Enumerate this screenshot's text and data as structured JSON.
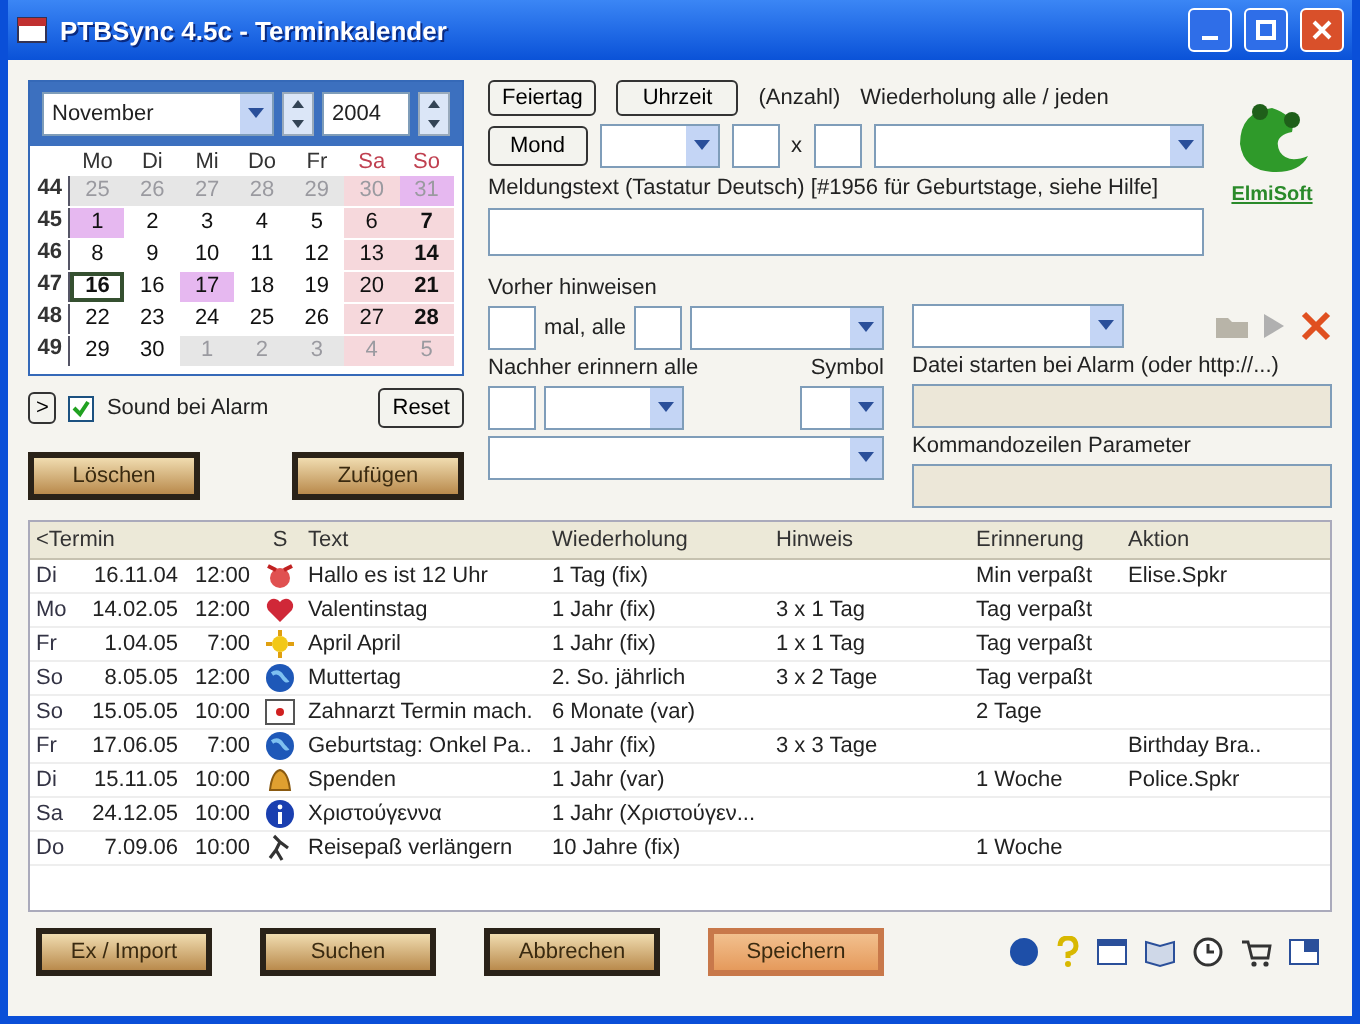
{
  "window": {
    "title": "PTBSync 4.5c - Terminkalender"
  },
  "calendar": {
    "month": "November",
    "year": "2004",
    "weekdays": [
      {
        "label": "Mo",
        "kind": "weekday"
      },
      {
        "label": "Di",
        "kind": "weekday"
      },
      {
        "label": "Mi",
        "kind": "weekday"
      },
      {
        "label": "Do",
        "kind": "weekday"
      },
      {
        "label": "Fr",
        "kind": "weekday"
      },
      {
        "label": "Sa",
        "kind": "saturday"
      },
      {
        "label": "So",
        "kind": "sunday"
      }
    ],
    "weeks": [
      {
        "number": "44",
        "days": [
          {
            "label": "25",
            "muted": true,
            "marked": false,
            "today": false
          },
          {
            "label": "26",
            "muted": true,
            "marked": false,
            "today": false
          },
          {
            "label": "27",
            "muted": true,
            "marked": false,
            "today": false
          },
          {
            "label": "28",
            "muted": true,
            "marked": false,
            "today": false
          },
          {
            "label": "29",
            "muted": true,
            "marked": false,
            "today": false
          },
          {
            "label": "30",
            "muted": true,
            "marked": false,
            "today": false
          },
          {
            "label": "31",
            "muted": true,
            "marked": true,
            "today": false
          }
        ]
      },
      {
        "number": "45",
        "days": [
          {
            "label": "1",
            "muted": false,
            "marked": true,
            "today": false
          },
          {
            "label": "2",
            "muted": false,
            "marked": false,
            "today": false
          },
          {
            "label": "3",
            "muted": false,
            "marked": false,
            "today": false
          },
          {
            "label": "4",
            "muted": false,
            "marked": false,
            "today": false
          },
          {
            "label": "5",
            "muted": false,
            "marked": false,
            "today": false
          },
          {
            "label": "6",
            "muted": false,
            "marked": false,
            "today": false
          },
          {
            "label": "7",
            "muted": false,
            "marked": false,
            "today": false
          }
        ]
      },
      {
        "number": "46",
        "days": [
          {
            "label": "8",
            "muted": false,
            "marked": false,
            "today": false
          },
          {
            "label": "9",
            "muted": false,
            "marked": false,
            "today": false
          },
          {
            "label": "10",
            "muted": false,
            "marked": false,
            "today": false
          },
          {
            "label": "11",
            "muted": false,
            "marked": false,
            "today": false
          },
          {
            "label": "12",
            "muted": false,
            "marked": false,
            "today": false
          },
          {
            "label": "13",
            "muted": false,
            "marked": false,
            "today": false
          },
          {
            "label": "14",
            "muted": false,
            "marked": false,
            "today": false
          }
        ]
      },
      {
        "number": "47",
        "days": [
          {
            "label": "16",
            "muted": false,
            "marked": false,
            "today": true
          },
          {
            "label": "16",
            "muted": false,
            "marked": false,
            "today": false
          },
          {
            "label": "17",
            "muted": false,
            "marked": true,
            "today": false
          },
          {
            "label": "18",
            "muted": false,
            "marked": false,
            "today": false
          },
          {
            "label": "19",
            "muted": false,
            "marked": false,
            "today": false
          },
          {
            "label": "20",
            "muted": false,
            "marked": false,
            "today": false
          },
          {
            "label": "21",
            "muted": false,
            "marked": false,
            "today": false
          }
        ]
      },
      {
        "number": "48",
        "days": [
          {
            "label": "22",
            "muted": false,
            "marked": false,
            "today": false
          },
          {
            "label": "23",
            "muted": false,
            "marked": false,
            "today": false
          },
          {
            "label": "24",
            "muted": false,
            "marked": false,
            "today": false
          },
          {
            "label": "25",
            "muted": false,
            "marked": false,
            "today": false
          },
          {
            "label": "26",
            "muted": false,
            "marked": false,
            "today": false
          },
          {
            "label": "27",
            "muted": false,
            "marked": false,
            "today": false
          },
          {
            "label": "28",
            "muted": false,
            "marked": false,
            "today": false
          }
        ]
      },
      {
        "number": "49",
        "days": [
          {
            "label": "29",
            "muted": false,
            "marked": false,
            "today": false
          },
          {
            "label": "30",
            "muted": false,
            "marked": false,
            "today": false
          },
          {
            "label": "1",
            "muted": true,
            "marked": false,
            "today": false
          },
          {
            "label": "2",
            "muted": true,
            "marked": false,
            "today": false
          },
          {
            "label": "3",
            "muted": true,
            "marked": false,
            "today": false
          },
          {
            "label": "4",
            "muted": true,
            "marked": false,
            "today": false
          },
          {
            "label": "5",
            "muted": true,
            "marked": false,
            "today": false
          }
        ]
      }
    ]
  },
  "expand_button": ">",
  "sound": {
    "label": "Sound bei Alarm",
    "checked": true
  },
  "reset_button": "Reset",
  "left_buttons": [
    "Löschen",
    "Zufügen"
  ],
  "form": {
    "holiday_button": "Feiertag",
    "time_button": "Uhrzeit",
    "moon_button": "Mond",
    "count_label": "(Anzahl)",
    "repeat_label": "Wiederholung alle / jeden",
    "times_sign": "x",
    "message_label": "Meldungstext (Tastatur Deutsch) [#1956 für Geburtstage, siehe Hilfe]",
    "before_label": "Vorher hinweisen",
    "before_every": "mal, alle",
    "after_label": "Nachher erinnern alle",
    "symbol_label": "Symbol",
    "file_label": "Datei starten bei Alarm (oder http://...)",
    "file_field": {
      "disabled": true
    },
    "params_label": "Kommandozeilen Parameter",
    "params_field": {
      "disabled": true
    }
  },
  "logo": {
    "text": "ElmiSoft"
  },
  "table": {
    "columns": [
      "<Termin",
      "S",
      "Text",
      "Wiederholung",
      "Hinweis",
      "Erinnerung",
      "Aktion"
    ],
    "rows": [
      {
        "day": "Di",
        "date": "16.11.04",
        "time": "12:00",
        "text": "Hallo es ist 12 Uhr",
        "repeat": "1 Tag  (fix)",
        "hint": "",
        "reminder": "Min verpaßt",
        "action": "Elise.Spkr"
      },
      {
        "day": "Mo",
        "date": "14.02.05",
        "time": "12:00",
        "text": "Valentinstag",
        "repeat": "1 Jahr  (fix)",
        "hint": "3 x 1 Tag",
        "reminder": "Tag verpaßt",
        "action": ""
      },
      {
        "day": "Fr",
        "date": "1.04.05",
        "time": "7:00",
        "text": "April April",
        "repeat": "1 Jahr  (fix)",
        "hint": "1 x 1 Tag",
        "reminder": "Tag verpaßt",
        "action": ""
      },
      {
        "day": "So",
        "date": "8.05.05",
        "time": "12:00",
        "text": "Muttertag",
        "repeat": "2. So. jährlich",
        "hint": "3 x 2 Tage",
        "reminder": "Tag verpaßt",
        "action": ""
      },
      {
        "day": "So",
        "date": "15.05.05",
        "time": "10:00",
        "text": "Zahnarzt Termin mach.",
        "repeat": "6 Monate  (var)",
        "hint": "",
        "reminder": "2 Tage",
        "action": ""
      },
      {
        "day": "Fr",
        "date": "17.06.05",
        "time": "7:00",
        "text": "Geburtstag: Onkel Pa..",
        "repeat": "1 Jahr  (fix)",
        "hint": "3 x 3 Tage",
        "reminder": "",
        "action": "Birthday Bra.."
      },
      {
        "day": "Di",
        "date": "15.11.05",
        "time": "10:00",
        "text": "Spenden",
        "repeat": "1 Jahr  (var)",
        "hint": "",
        "reminder": "1 Woche",
        "action": "Police.Spkr"
      },
      {
        "day": "Sa",
        "date": "24.12.05",
        "time": "10:00",
        "text": "Χριστούγεννα",
        "repeat": "1 Jahr (Χριστούγεν...",
        "hint": "",
        "reminder": "",
        "action": ""
      },
      {
        "day": "Do",
        "date": "7.09.06",
        "time": "10:00",
        "text": "Reisepaß verlängern",
        "repeat": "10 Jahre  (fix)",
        "hint": "",
        "reminder": "1 Woche",
        "action": ""
      }
    ]
  },
  "bottom_buttons": [
    {
      "label": "Ex / Import",
      "selected": false
    },
    {
      "label": "Suchen",
      "selected": false
    },
    {
      "label": "Abbrechen",
      "selected": false
    },
    {
      "label": "Speichern",
      "selected": true
    }
  ]
}
